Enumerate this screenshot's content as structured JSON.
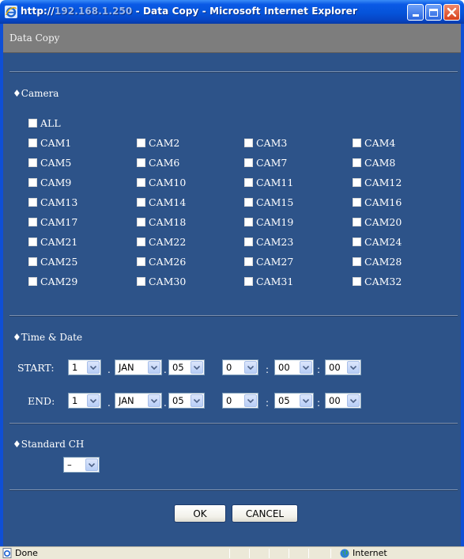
{
  "window": {
    "title_prefix": "http://",
    "title_host": "192.168.1.250",
    "title_suffix": " - Data Copy - Microsoft Internet Explorer"
  },
  "page": {
    "header": "Data Copy"
  },
  "camera": {
    "section_label": "♦Camera",
    "all_label": "ALL",
    "cams": [
      "CAM1",
      "CAM2",
      "CAM3",
      "CAM4",
      "CAM5",
      "CAM6",
      "CAM7",
      "CAM8",
      "CAM9",
      "CAM10",
      "CAM11",
      "CAM12",
      "CAM13",
      "CAM14",
      "CAM15",
      "CAM16",
      "CAM17",
      "CAM18",
      "CAM19",
      "CAM20",
      "CAM21",
      "CAM22",
      "CAM23",
      "CAM24",
      "CAM25",
      "CAM26",
      "CAM27",
      "CAM28",
      "CAM29",
      "CAM30",
      "CAM31",
      "CAM32"
    ]
  },
  "time_date": {
    "section_label": "♦Time & Date",
    "start": {
      "label": "START:",
      "day": "1",
      "month": "JAN",
      "year": "05",
      "hour": "0",
      "minute": "00",
      "second": "00"
    },
    "end": {
      "label": "END:",
      "day": "1",
      "month": "JAN",
      "year": "05",
      "hour": "0",
      "minute": "05",
      "second": "00"
    },
    "date_sep": ".",
    "time_sep": ":"
  },
  "standard_ch": {
    "section_label": "♦Standard CH",
    "value": "–"
  },
  "buttons": {
    "ok": "OK",
    "cancel": "CANCEL"
  },
  "status": {
    "text": "Done",
    "zone": "Internet"
  },
  "colors": {
    "page_bg": "#2d5389",
    "header_band": "#7d7d7d",
    "title_bar": "#0553d9"
  }
}
